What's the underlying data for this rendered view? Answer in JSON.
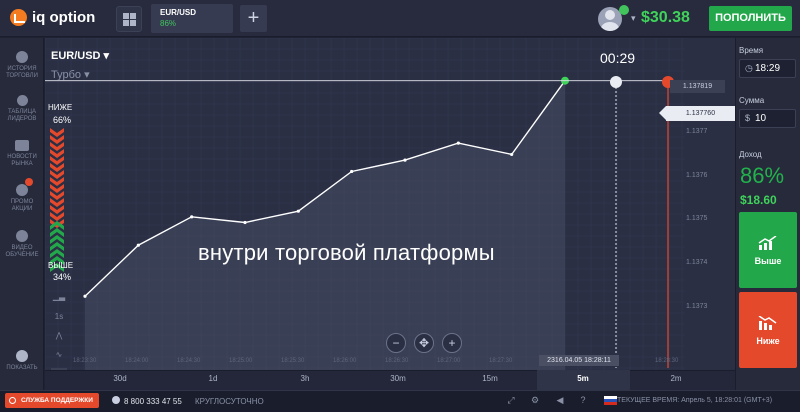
{
  "header": {
    "logo_text": "iq option",
    "tab": {
      "asset": "EUR/USD",
      "percent": "86%"
    },
    "plus_label": "+",
    "balance": "$30.38",
    "deposit_label": "ПОПОЛНИТЬ"
  },
  "sidebar": {
    "items": [
      {
        "label": "ИСТОРИЯ ТОРГОВЛИ",
        "icon": "history-icon"
      },
      {
        "label": "ТАБЛИЦА ЛИДЕРОВ",
        "icon": "leaderboard-icon"
      },
      {
        "label": "НОВОСТИ РЫНКА",
        "icon": "news-icon"
      },
      {
        "label": "ПРОМО АКЦИИ",
        "icon": "promo-icon"
      },
      {
        "label": "ВИДЕО ОБУЧЕНИЕ",
        "icon": "video-icon"
      }
    ],
    "show_label": "ПОКАЗАТЬ",
    "promo_badge": "!"
  },
  "chart": {
    "asset_label": "EUR/USD ▾",
    "mode_label": "Турбо ▾",
    "timer": "00:29",
    "lower_label": "НИЖЕ",
    "lower_percent": "66%",
    "higher_label": "ВЫШЕ",
    "higher_percent": "34%",
    "current_price": "1.137760",
    "expiry_price": "1.137819",
    "caption": "внутри торговой платформы",
    "time_tooltip": "2316.04.05 18:28:11",
    "time_labels": [
      "18:23:30",
      "18:24:00",
      "18:24:30",
      "18:25:00",
      "18:25:30",
      "18:26:00",
      "18:26:30",
      "18:27:00",
      "18:27:30",
      "18:28:00",
      "18:28:30"
    ],
    "price_labels": [
      "1.1377",
      "1.1376",
      "1.1375",
      "1.1374",
      "1.1373"
    ],
    "zoom": {
      "minus": "−",
      "center": "✥",
      "plus": "+"
    },
    "colors": {
      "up": "#22a84a",
      "down": "#e5492c",
      "line": "#ffffff"
    }
  },
  "chart_data": {
    "type": "line",
    "x": [
      "18:23:30",
      "18:24:00",
      "18:24:30",
      "18:25:00",
      "18:25:30",
      "18:26:00",
      "18:26:30",
      "18:27:00",
      "18:27:30",
      "18:28:00"
    ],
    "y": [
      1.13738,
      1.13747,
      1.13752,
      1.13751,
      1.13753,
      1.1376,
      1.13762,
      1.13765,
      1.13763,
      1.13776
    ],
    "ylim": [
      1.13725,
      1.1378
    ],
    "grid": true
  },
  "periods": [
    "30d",
    "1d",
    "3h",
    "30m",
    "15m",
    "5m",
    "2m"
  ],
  "active_period": "5m",
  "right_panel": {
    "time_label": "Время",
    "time_value": "18:29",
    "amount_label": "Сумма",
    "amount_prefix": "$",
    "amount_value": "10",
    "profit_label": "Доход",
    "profit_percent": "86%",
    "profit_amount": "$18.60",
    "up_label": "Выше",
    "down_label": "Ниже"
  },
  "footer": {
    "support_label": "СЛУЖБА ПОДДЕРЖКИ",
    "phone": "8 800 333 47 55",
    "round_clock": "КРУГЛОСУТОЧНО",
    "current_time": "ТЕКУЩЕЕ ВРЕМЯ: Апрель 5, 18:28:01 (GMT+3)"
  }
}
